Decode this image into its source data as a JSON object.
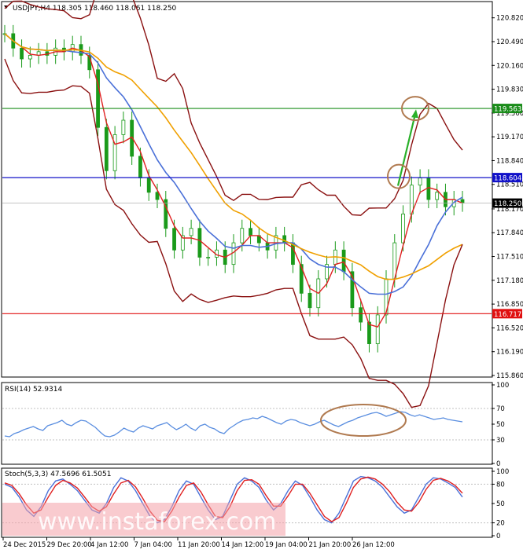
{
  "header": {
    "symbol_line": "USDJPY,H4  118.305 118.460 118.061 118.250"
  },
  "chart_data": [
    {
      "type": "line",
      "name_shown": "USDJPY,H4",
      "ohlc": [
        "118.305",
        "118.460",
        "118.061",
        "118.250"
      ],
      "y_ticks": [
        "120.820",
        "120.490",
        "120.160",
        "119.830",
        "119.500",
        "119.170",
        "118.840",
        "118.510",
        "118.170",
        "117.840",
        "117.510",
        "117.180",
        "116.850",
        "116.520",
        "116.190",
        "115.860"
      ],
      "ylim": [
        115.86,
        120.98
      ],
      "x_ticks": [
        "24 Dec 2015",
        "29 Dec 20:00",
        "4 Jan 12:00",
        "7 Jan 04:00",
        "11 Jan 20:00",
        "14 Jan 12:00",
        "19 Jan 04:00",
        "21 Jan 20:00",
        "26 Jan 12:00"
      ],
      "price_close_approx": [
        120.6,
        120.4,
        120.25,
        120.3,
        120.35,
        120.3,
        120.4,
        120.35,
        120.45,
        120.3,
        120.1,
        119.3,
        118.7,
        119.2,
        119.4,
        118.9,
        118.6,
        118.4,
        118.3,
        117.9,
        117.6,
        117.8,
        117.9,
        117.5,
        117.5,
        117.6,
        117.4,
        117.7,
        117.9,
        117.8,
        117.7,
        117.6,
        117.8,
        117.7,
        117.4,
        117.0,
        116.8,
        117.2,
        117.4,
        117.6,
        117.3,
        116.8,
        116.6,
        116.3,
        116.7,
        117.2,
        117.7,
        118.1,
        118.5,
        118.6,
        118.3,
        118.4,
        118.2,
        118.3,
        118.25
      ],
      "levels": [
        {
          "value": 119.563,
          "label": "119.563",
          "color": "#1a8c1a"
        },
        {
          "value": 118.604,
          "label": "118.604",
          "color": "#1010c8"
        },
        {
          "value": 116.717,
          "label": "116.717",
          "color": "#e01010"
        }
      ],
      "current_price": {
        "value": 118.25,
        "label": "118.250"
      },
      "annotation": {
        "type": "arrow",
        "color": "#2ab02a",
        "from": 118.6,
        "to": 119.55
      },
      "colors": {
        "price": "#1a9a1a",
        "ma_fast": "#e02020",
        "ma_mid": "#4a70d8",
        "ma_slow": "#f0a000",
        "bollinger": "#8a1010",
        "circle": "#b07a50"
      }
    },
    {
      "type": "line",
      "indicator_label": "RSI(14) 52.9314",
      "y_ticks": [
        "100",
        "70",
        "50",
        "30",
        "0"
      ],
      "ylim": [
        0,
        100
      ],
      "rsi_approx": [
        35,
        34,
        38,
        40,
        43,
        45,
        47,
        44,
        42,
        48,
        50,
        52,
        55,
        50,
        48,
        52,
        55,
        54,
        50,
        46,
        40,
        35,
        34,
        36,
        40,
        45,
        42,
        40,
        45,
        48,
        46,
        44,
        48,
        50,
        52,
        47,
        43,
        46,
        50,
        45,
        42,
        48,
        50,
        46,
        44,
        40,
        38,
        44,
        48,
        52,
        55,
        56,
        58,
        57,
        60,
        58,
        55,
        52,
        50,
        54,
        56,
        55,
        52,
        50,
        48,
        50,
        53,
        55,
        52,
        49,
        47,
        50,
        53,
        55,
        58,
        60,
        62,
        64,
        65,
        63,
        60,
        62,
        64,
        66,
        65,
        62,
        60,
        62,
        60,
        58,
        56,
        57,
        58,
        56,
        55,
        54,
        53
      ],
      "colors": {
        "line": "#5a8ee0",
        "circle": "#b07a50"
      }
    },
    {
      "type": "line",
      "indicator_label": "Stoch(5,3,3) 47.5696 61.5051",
      "y_ticks": [
        "100",
        "80",
        "50",
        "20",
        "0"
      ],
      "ylim": [
        0,
        100
      ],
      "series": [
        {
          "values": [
            80,
            75,
            60,
            40,
            30,
            45,
            70,
            85,
            88,
            80,
            70,
            55,
            40,
            35,
            50,
            75,
            90,
            85,
            70,
            50,
            30,
            20,
            25,
            45,
            70,
            85,
            80,
            60,
            40,
            25,
            30,
            55,
            80,
            90,
            85,
            75,
            55,
            40,
            50,
            70,
            85,
            78,
            60,
            40,
            25,
            20,
            35,
            60,
            85,
            92,
            90,
            85,
            75,
            60,
            45,
            35,
            40,
            60,
            80,
            90,
            88,
            82,
            75,
            60
          ],
          "color": "#4a70d8"
        },
        {
          "values": [
            82,
            78,
            65,
            48,
            35,
            40,
            60,
            78,
            86,
            82,
            74,
            60,
            45,
            38,
            45,
            65,
            82,
            86,
            76,
            58,
            38,
            24,
            22,
            38,
            60,
            78,
            82,
            68,
            48,
            30,
            28,
            45,
            70,
            86,
            87,
            80,
            62,
            46,
            46,
            62,
            80,
            80,
            66,
            48,
            30,
            22,
            28,
            50,
            75,
            88,
            91,
            88,
            80,
            68,
            52,
            40,
            38,
            52,
            72,
            86,
            89,
            85,
            78,
            66
          ],
          "color": "#e02020"
        }
      ]
    }
  ],
  "watermark": {
    "text": "www.instaforex.com"
  }
}
